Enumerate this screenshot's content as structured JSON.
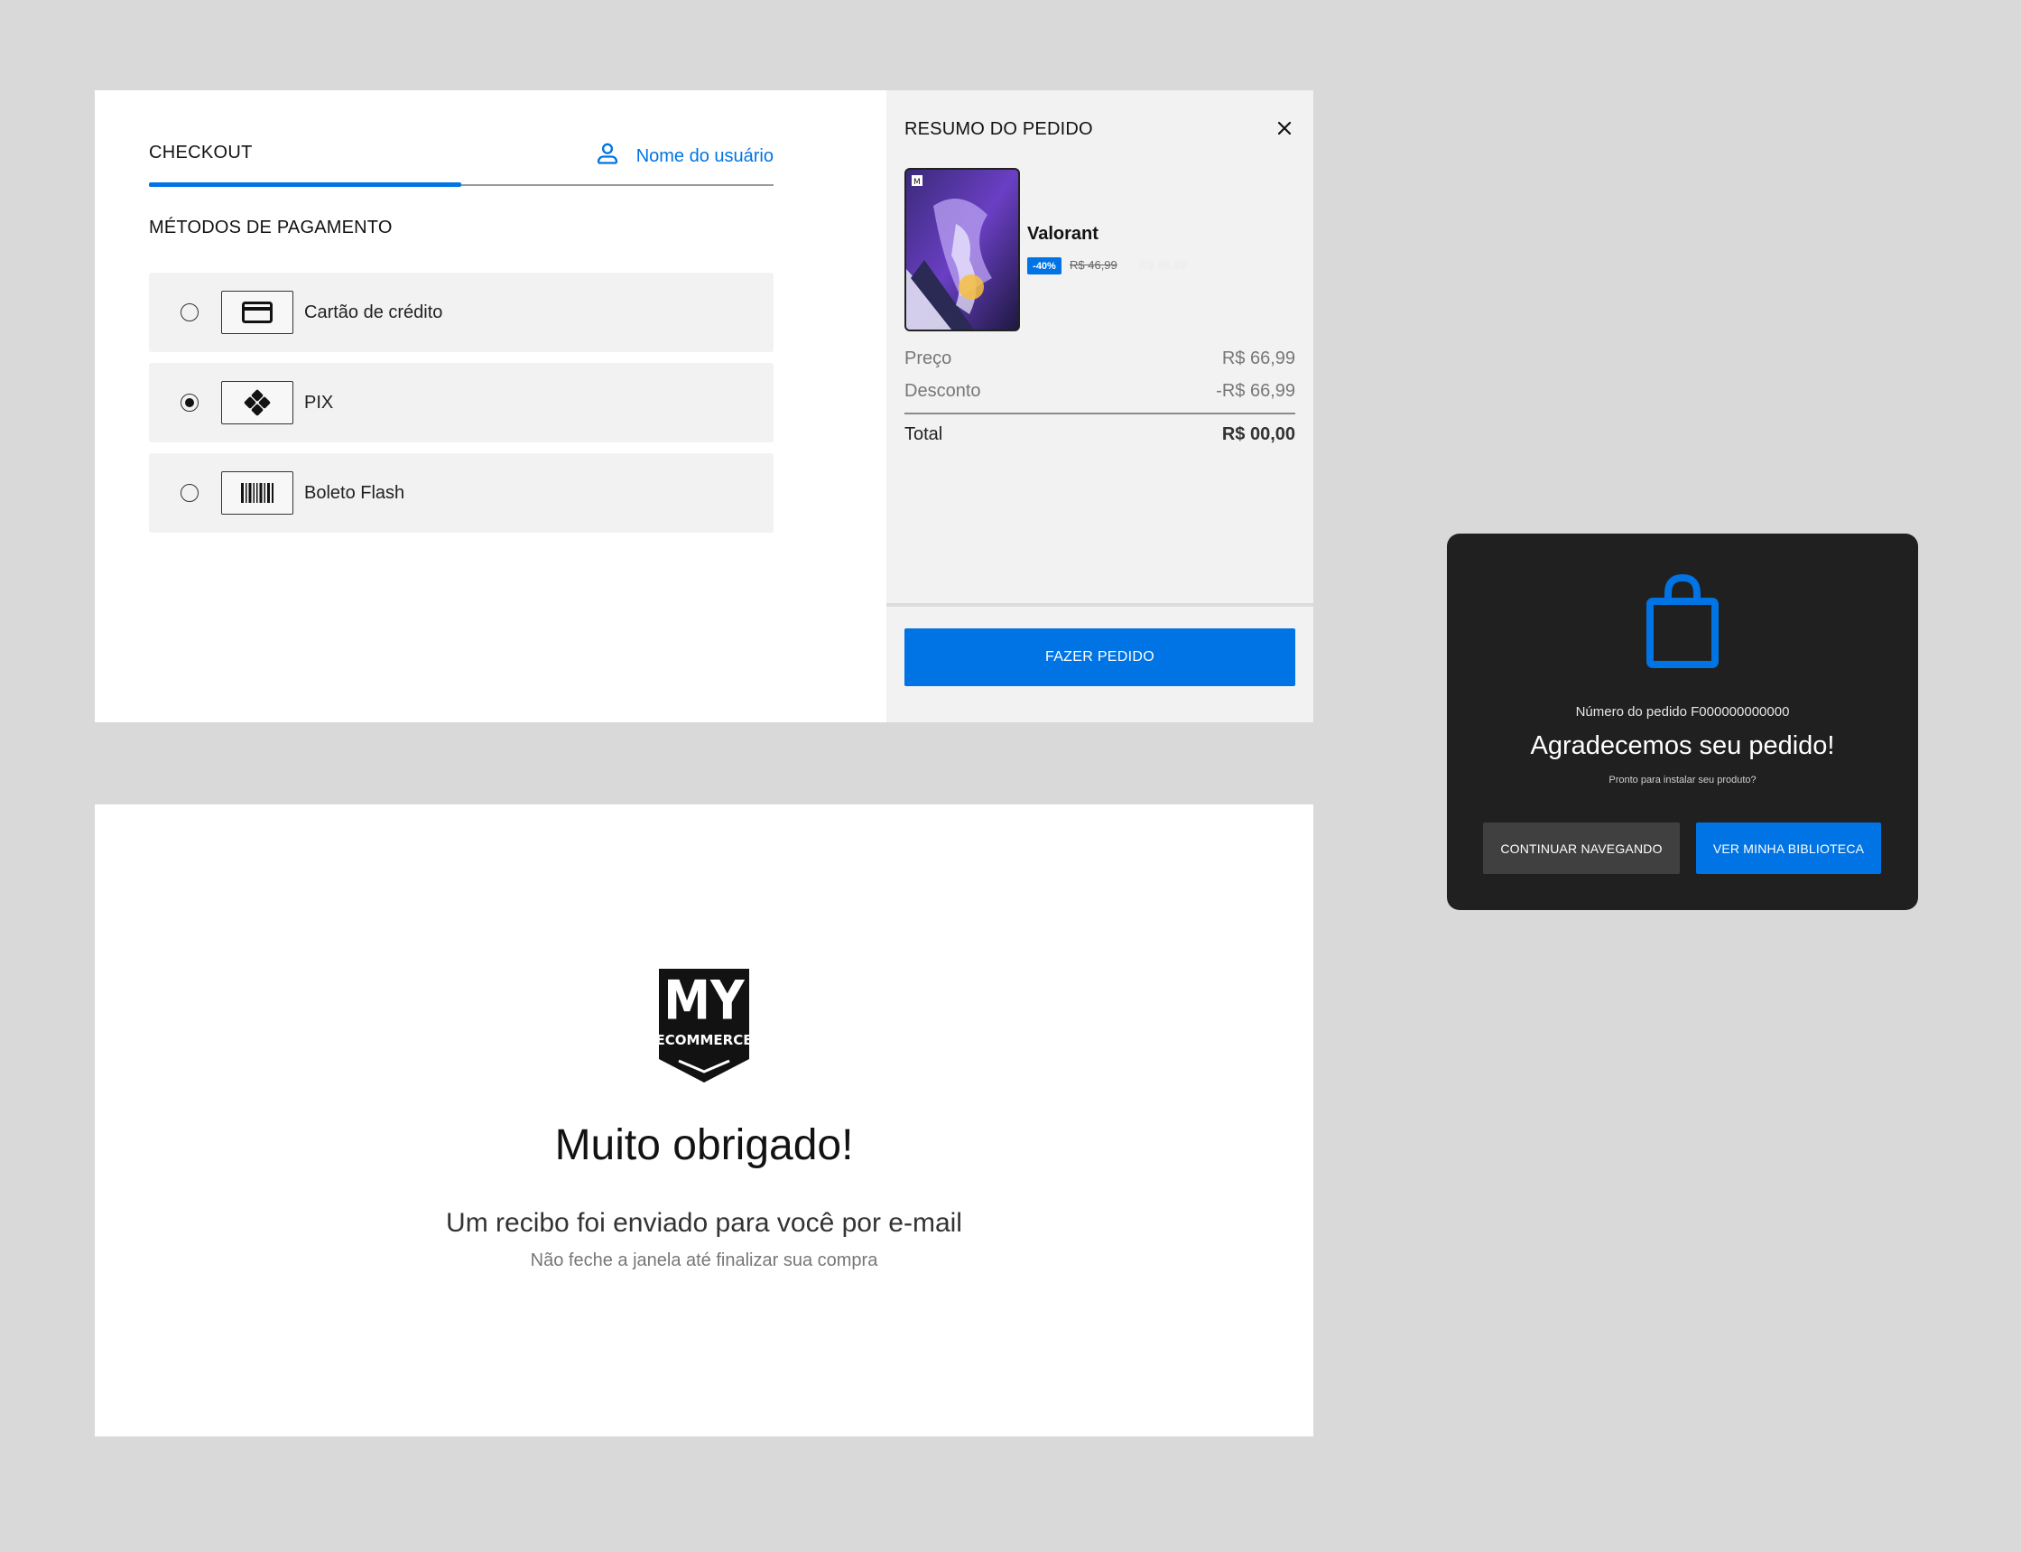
{
  "checkout": {
    "tab_label": "CHECKOUT",
    "user_label": "Nome do usuário",
    "methods_title": "MÉTODOS DE PAGAMENTO",
    "methods": [
      {
        "label": "Cartão de crédito",
        "icon": "credit-card-icon",
        "selected": false
      },
      {
        "label": "PIX",
        "icon": "pix-icon",
        "selected": true
      },
      {
        "label": "Boleto Flash",
        "icon": "barcode-icon",
        "selected": false
      }
    ]
  },
  "summary": {
    "title": "RESUMO DO PEDIDO",
    "product_name": "Valorant",
    "discount_badge": "-40%",
    "old_price": "R$ 46,99",
    "new_price": "R$ 66,99",
    "price_label": "Preço",
    "price_value": "R$ 66,99",
    "discount_label": "Desconto",
    "discount_value": "-R$ 66,99",
    "total_label": "Total",
    "total_value": "R$ 00,00",
    "order_button": "FAZER PEDIDO"
  },
  "thanks": {
    "logo_top": "MY",
    "logo_bottom": "ECOMMERCE",
    "title": "Muito obrigado!",
    "subtitle": "Um recibo foi enviado para você por e-mail",
    "note": "Não feche a janela até finalizar sua compra"
  },
  "modal": {
    "order_number": "Número do pedido F000000000000",
    "title": "Agradecemos seu pedido!",
    "subtitle": "Pronto para instalar seu produto?",
    "continue_button": "CONTINUAR NAVEGANDO",
    "library_button": "VER MINHA BIBLIOTECA"
  },
  "colors": {
    "accent": "#0074e4",
    "background": "#d9d9d9",
    "modal_bg": "#202020",
    "summary_bg": "#f2f2f2"
  }
}
